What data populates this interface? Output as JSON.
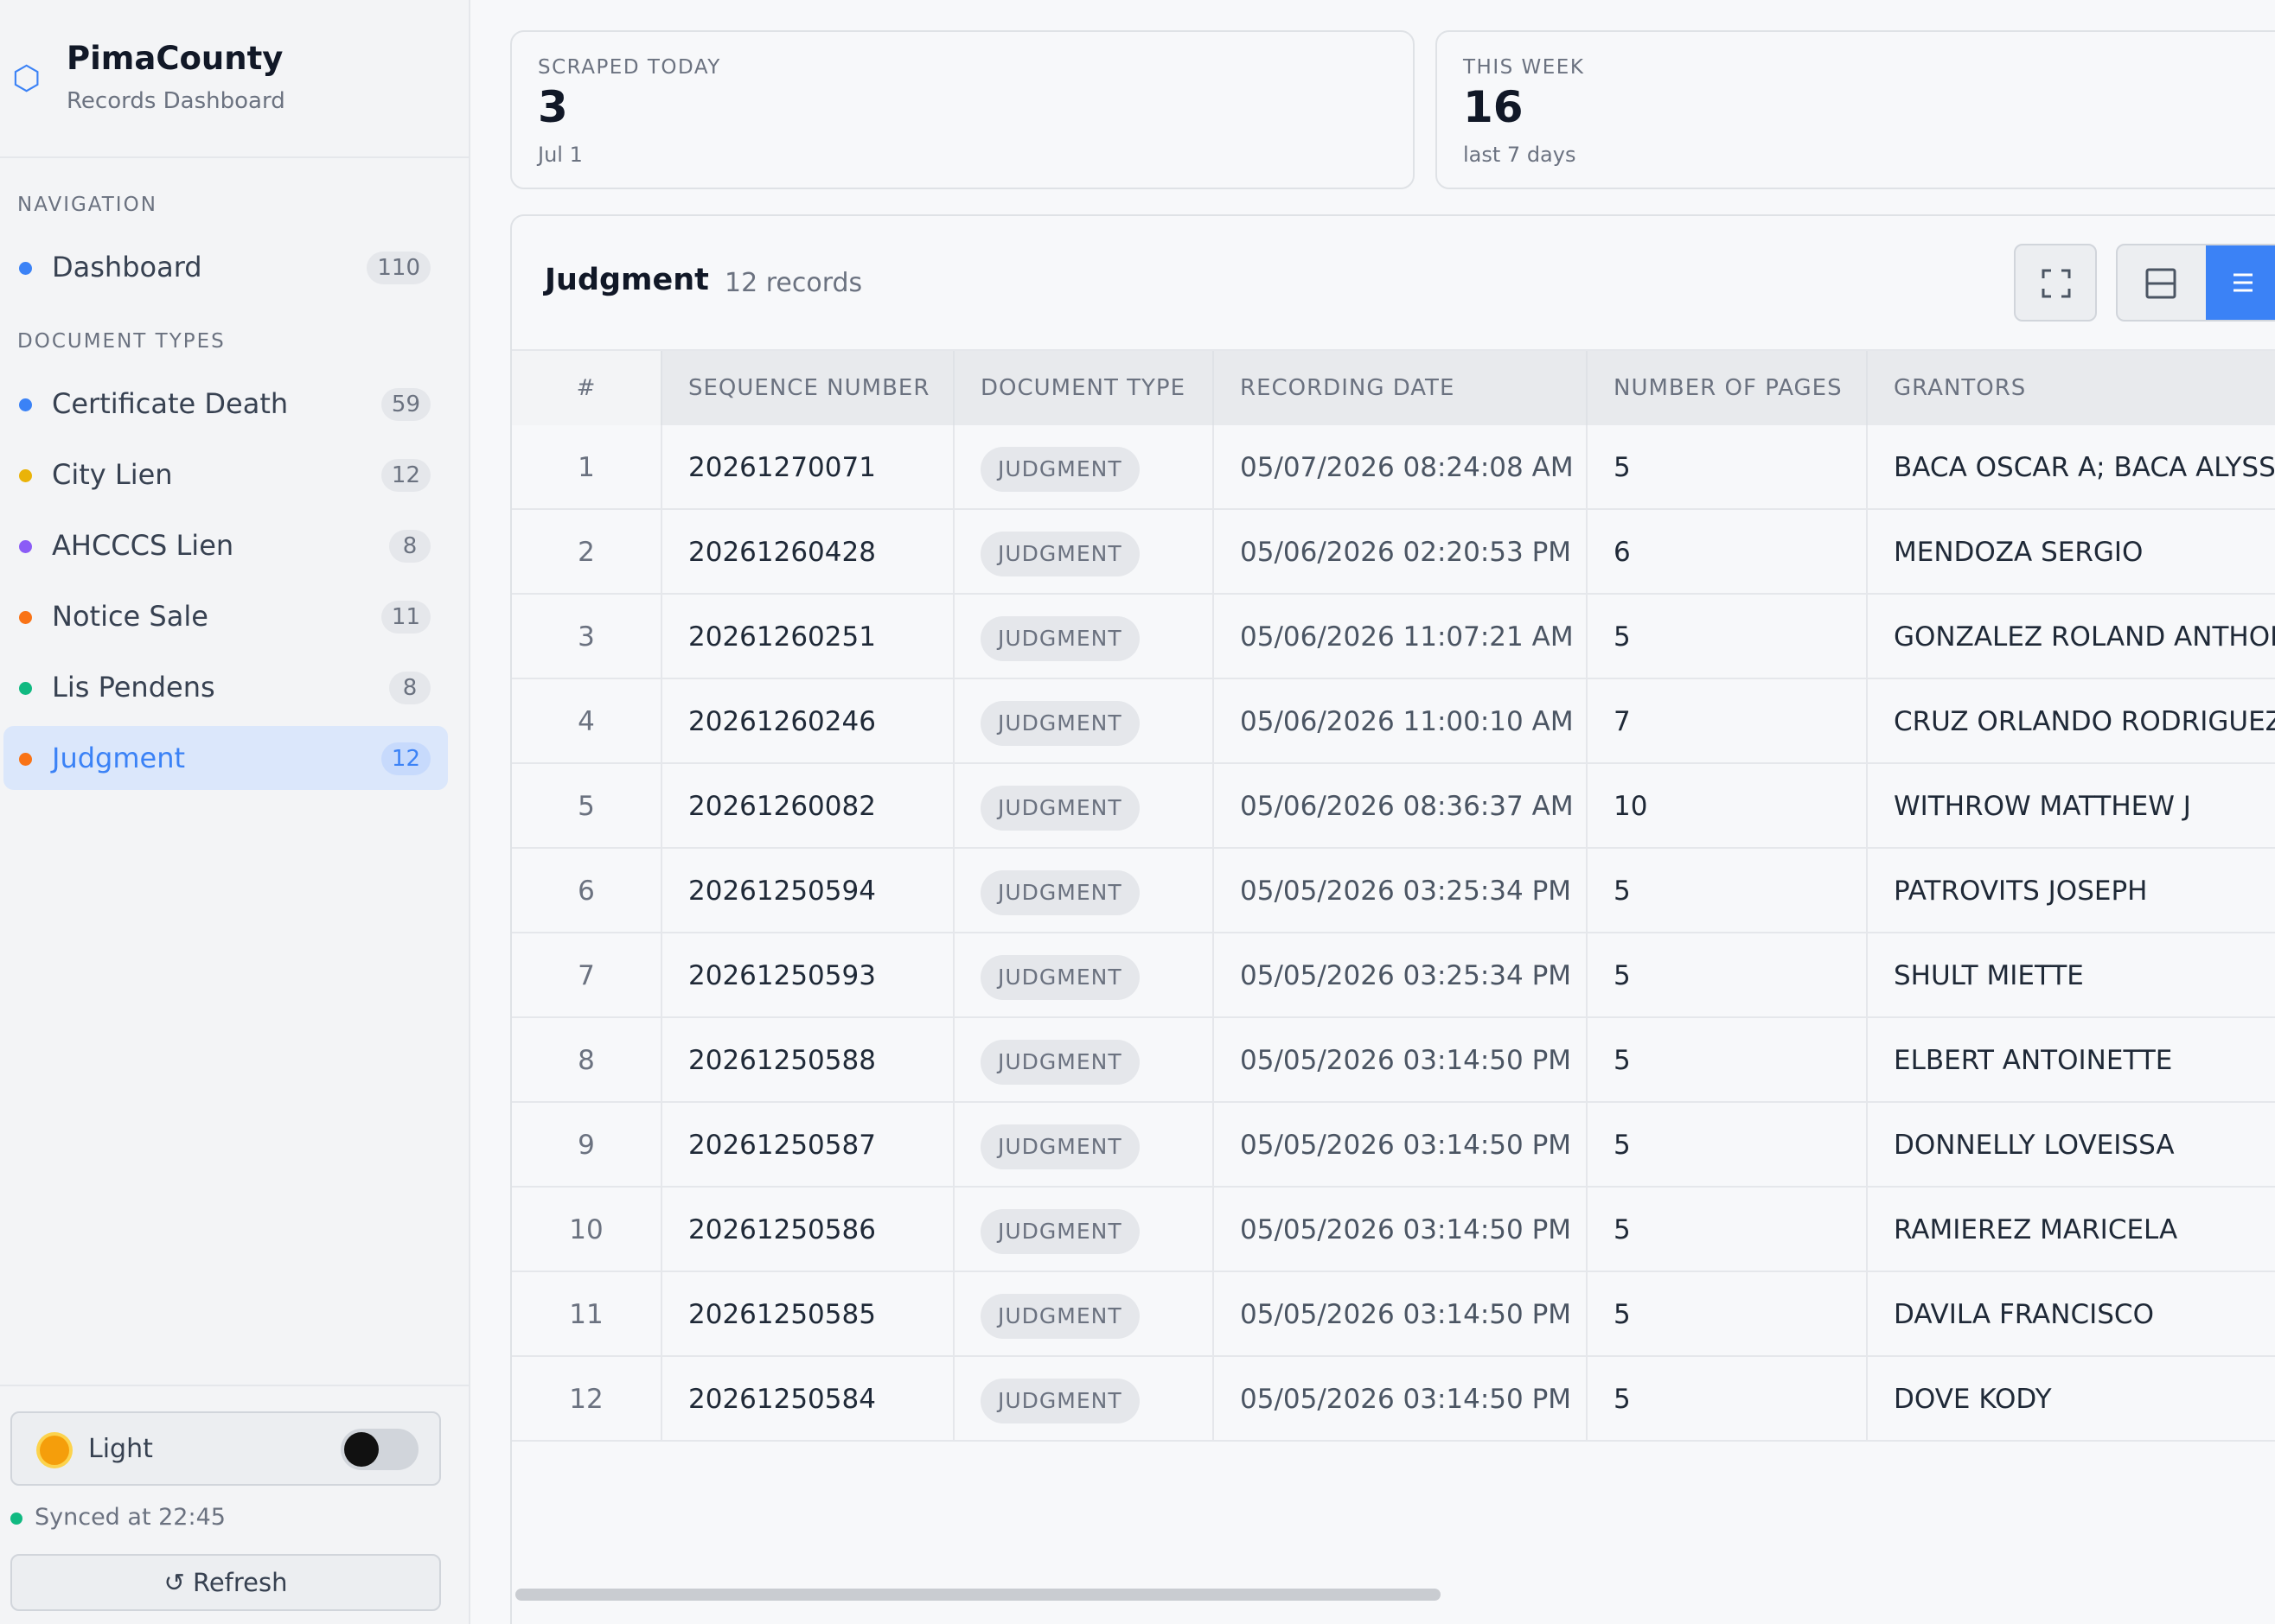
{
  "brand": {
    "title": "PimaCounty",
    "subtitle": "Records Dashboard"
  },
  "sidebar": {
    "navigation_label": "NAVIGATION",
    "navigation": [
      {
        "label": "Dashboard",
        "count": "110",
        "color": "#3b82f6"
      }
    ],
    "doc_types_label": "DOCUMENT TYPES",
    "doc_types": [
      {
        "label": "Certificate Death",
        "count": "59",
        "color": "#3b82f6"
      },
      {
        "label": "City Lien",
        "count": "12",
        "color": "#eab308"
      },
      {
        "label": "AHCCCS Lien",
        "count": "8",
        "color": "#8b5cf6"
      },
      {
        "label": "Notice Sale",
        "count": "11",
        "color": "#f97316"
      },
      {
        "label": "Lis Pendens",
        "count": "8",
        "color": "#10b981"
      },
      {
        "label": "Judgment",
        "count": "12",
        "color": "#f97316",
        "active": true
      }
    ],
    "theme_label": "Light",
    "sync_text": "Synced at 22:45",
    "refresh_label": "↺ Refresh"
  },
  "stats": [
    {
      "label": "SCRAPED TODAY",
      "value": "3",
      "sub": "Jul 1"
    },
    {
      "label": "THIS WEEK",
      "value": "16",
      "sub": "last 7 days"
    }
  ],
  "panel": {
    "title": "Judgment",
    "count_text": "12 records",
    "columns": [
      "#",
      "SEQUENCE NUMBER",
      "DOCUMENT TYPE",
      "RECORDING DATE",
      "NUMBER OF PAGES",
      "GRANTORS"
    ],
    "rows": [
      {
        "idx": "1",
        "seq": "20261270071",
        "type": "JUDGMENT",
        "date": "05/07/2026 08:24:08 AM",
        "pages": "5",
        "grantors": "BACA OSCAR A; BACA ALYSSA"
      },
      {
        "idx": "2",
        "seq": "20261260428",
        "type": "JUDGMENT",
        "date": "05/06/2026 02:20:53 PM",
        "pages": "6",
        "grantors": "MENDOZA SERGIO"
      },
      {
        "idx": "3",
        "seq": "20261260251",
        "type": "JUDGMENT",
        "date": "05/06/2026 11:07:21 AM",
        "pages": "5",
        "grantors": "GONZALEZ ROLAND ANTHONY"
      },
      {
        "idx": "4",
        "seq": "20261260246",
        "type": "JUDGMENT",
        "date": "05/06/2026 11:00:10 AM",
        "pages": "7",
        "grantors": "CRUZ ORLANDO RODRIGUEZ;"
      },
      {
        "idx": "5",
        "seq": "20261260082",
        "type": "JUDGMENT",
        "date": "05/06/2026 08:36:37 AM",
        "pages": "10",
        "grantors": "WITHROW MATTHEW J"
      },
      {
        "idx": "6",
        "seq": "20261250594",
        "type": "JUDGMENT",
        "date": "05/05/2026 03:25:34 PM",
        "pages": "5",
        "grantors": "PATROVITS JOSEPH"
      },
      {
        "idx": "7",
        "seq": "20261250593",
        "type": "JUDGMENT",
        "date": "05/05/2026 03:25:34 PM",
        "pages": "5",
        "grantors": "SHULT MIETTE"
      },
      {
        "idx": "8",
        "seq": "20261250588",
        "type": "JUDGMENT",
        "date": "05/05/2026 03:14:50 PM",
        "pages": "5",
        "grantors": "ELBERT ANTOINETTE"
      },
      {
        "idx": "9",
        "seq": "20261250587",
        "type": "JUDGMENT",
        "date": "05/05/2026 03:14:50 PM",
        "pages": "5",
        "grantors": "DONNELLY LOVEISSA"
      },
      {
        "idx": "10",
        "seq": "20261250586",
        "type": "JUDGMENT",
        "date": "05/05/2026 03:14:50 PM",
        "pages": "5",
        "grantors": "RAMIEREZ MARICELA"
      },
      {
        "idx": "11",
        "seq": "20261250585",
        "type": "JUDGMENT",
        "date": "05/05/2026 03:14:50 PM",
        "pages": "5",
        "grantors": "DAVILA FRANCISCO"
      },
      {
        "idx": "12",
        "seq": "20261250584",
        "type": "JUDGMENT",
        "date": "05/05/2026 03:14:50 PM",
        "pages": "5",
        "grantors": "DOVE KODY"
      }
    ]
  },
  "icons": {
    "brand": "hexagon-icon",
    "theme": "sun-icon",
    "expand": "fullscreen-icon",
    "split_view": "split-view-icon",
    "list_view": "list-view-icon"
  },
  "colors": {
    "accent": "#3b82f6",
    "success": "#10b981"
  }
}
